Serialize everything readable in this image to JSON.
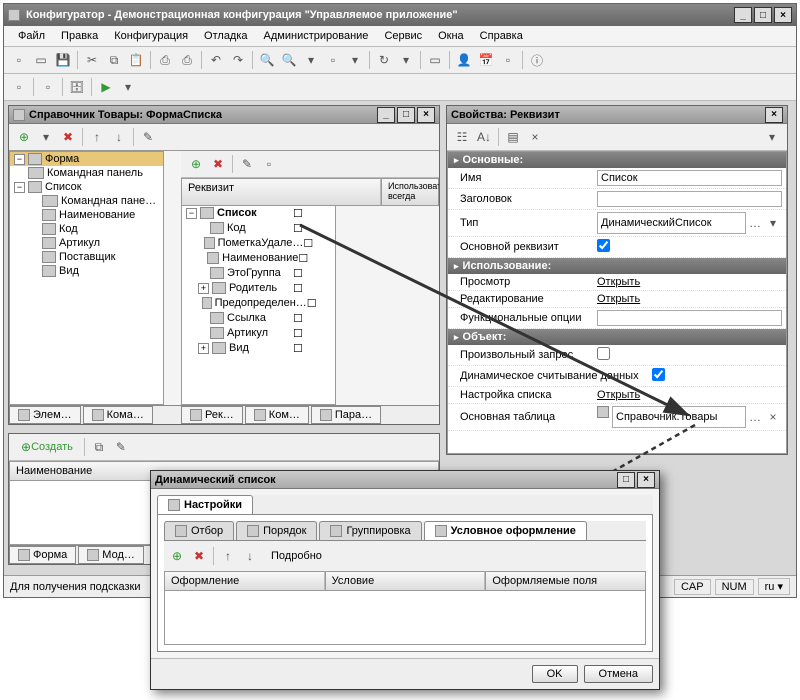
{
  "main": {
    "title": "Конфигуратор - Демонстрационная конфигурация \"Управляемое приложение\"",
    "menu": [
      "Файл",
      "Правка",
      "Конфигурация",
      "Отладка",
      "Администрирование",
      "Сервис",
      "Окна",
      "Справка"
    ],
    "status_hint": "Для получения подсказки",
    "status_cells": [
      "CAP",
      "NUM",
      "ru ▾"
    ]
  },
  "form_window": {
    "title": "Справочник Товары: ФормаСписка",
    "left_root": "Форма",
    "left_tree": [
      "Командная панель",
      "Список",
      "Командная пане…",
      "Наименование",
      "Код",
      "Артикул",
      "Поставщик",
      "Вид"
    ],
    "req_header": "Реквизит",
    "req_col2": "Использовать всегда",
    "req_root": "Список",
    "req_items": [
      "Код",
      "ПометкаУдале…",
      "Наименование",
      "ЭтоГруппа",
      "Родитель",
      "Предопределен…",
      "Ссылка",
      "Артикул",
      "Вид"
    ],
    "bottom_tabs_left": [
      "Элем…",
      "Кома…"
    ],
    "bottom_tabs_right": [
      "Рек…",
      "Ком…",
      "Пара…"
    ],
    "create": "Создать",
    "col_name": "Наименование",
    "foot_tabs": [
      "Форма",
      "Мод…"
    ]
  },
  "props_window": {
    "title": "Свойства: Реквизит",
    "sections": {
      "main": "Основные:",
      "use": "Использование:",
      "obj": "Объект:"
    },
    "labels": {
      "name": "Имя",
      "caption": "Заголовок",
      "type": "Тип",
      "main_req": "Основной реквизит",
      "view": "Просмотр",
      "edit": "Редактирование",
      "func": "Функциональные опции",
      "custom_q": "Произвольный запрос",
      "dyn_read": "Динамическое считывание данных",
      "list_setup": "Настройка списка",
      "main_table": "Основная таблица"
    },
    "values": {
      "name": "Список",
      "type": "ДинамическийСписок",
      "open": "Открыть",
      "main_table": "Справочник.Товары"
    }
  },
  "dialog": {
    "title": "Динамический список",
    "main_tab": "Настройки",
    "tabs": [
      "Отбор",
      "Порядок",
      "Группировка",
      "Условное оформление"
    ],
    "detail": "Подробно",
    "cols": [
      "Оформление",
      "Условие",
      "Оформляемые поля"
    ],
    "ok": "OK",
    "cancel": "Отмена"
  }
}
